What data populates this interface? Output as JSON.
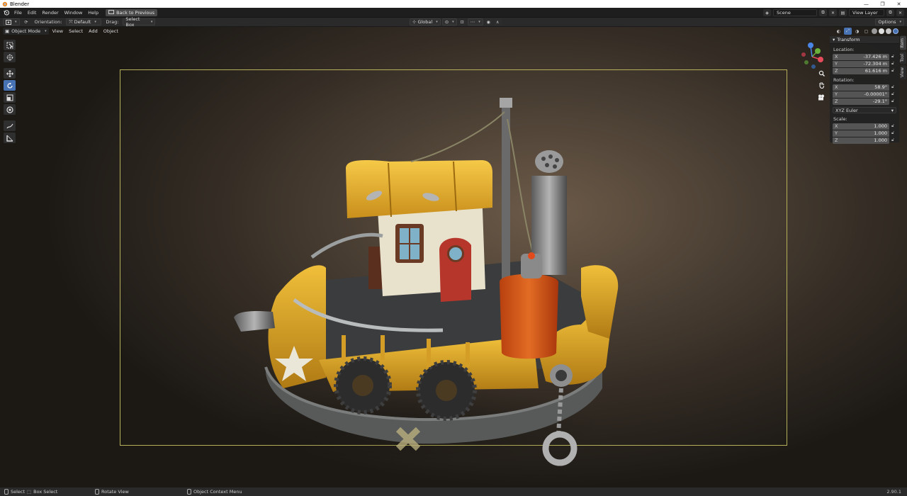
{
  "window": {
    "title": "Blender",
    "controls": [
      "—",
      "❐",
      "✕"
    ]
  },
  "topbar": {
    "menus": [
      "File",
      "Edit",
      "Render",
      "Window",
      "Help"
    ],
    "back_label": "Back to Previous",
    "scene": "Scene",
    "view_layer": "View Layer"
  },
  "toolheader": {
    "orientation_label": "Orientation:",
    "orientation_value": "Default",
    "drag_label": "Drag:",
    "drag_value": "Select Box",
    "transform_orientation": "Global",
    "options_label": "Options"
  },
  "viewport": {
    "mode": "Object Mode",
    "menus": [
      "View",
      "Select",
      "Add",
      "Object"
    ]
  },
  "gizmo": {
    "axes": [
      "X",
      "Y",
      "Z"
    ],
    "colors": {
      "x": "#e64c5c",
      "y": "#6ab23c",
      "z": "#4a86e8"
    }
  },
  "npanel": {
    "header": "Transform",
    "location_label": "Location:",
    "location": [
      {
        "axis": "X",
        "value": "-37.426 m"
      },
      {
        "axis": "Y",
        "value": "-72.304 m"
      },
      {
        "axis": "Z",
        "value": "61.616 m"
      }
    ],
    "rotation_label": "Rotation:",
    "rotation": [
      {
        "axis": "X",
        "value": "58.9°"
      },
      {
        "axis": "Y",
        "value": "-0.00001°"
      },
      {
        "axis": "Z",
        "value": "-29.1°"
      }
    ],
    "rotation_mode": "XYZ Euler",
    "scale_label": "Scale:",
    "scale": [
      {
        "axis": "X",
        "value": "1.000"
      },
      {
        "axis": "Y",
        "value": "1.000"
      },
      {
        "axis": "Z",
        "value": "1.000"
      }
    ],
    "tabs": [
      "Item",
      "Tool",
      "View"
    ]
  },
  "statusbar": {
    "select": "Select",
    "box_select": "Box Select",
    "rotate_view": "Rotate View",
    "context_menu": "Object Context Menu",
    "version": "2.90.1"
  },
  "colors": {
    "accent": "#4772b3",
    "camera_frame": "#b6b05a",
    "boat_yellow": "#e0a52a"
  }
}
